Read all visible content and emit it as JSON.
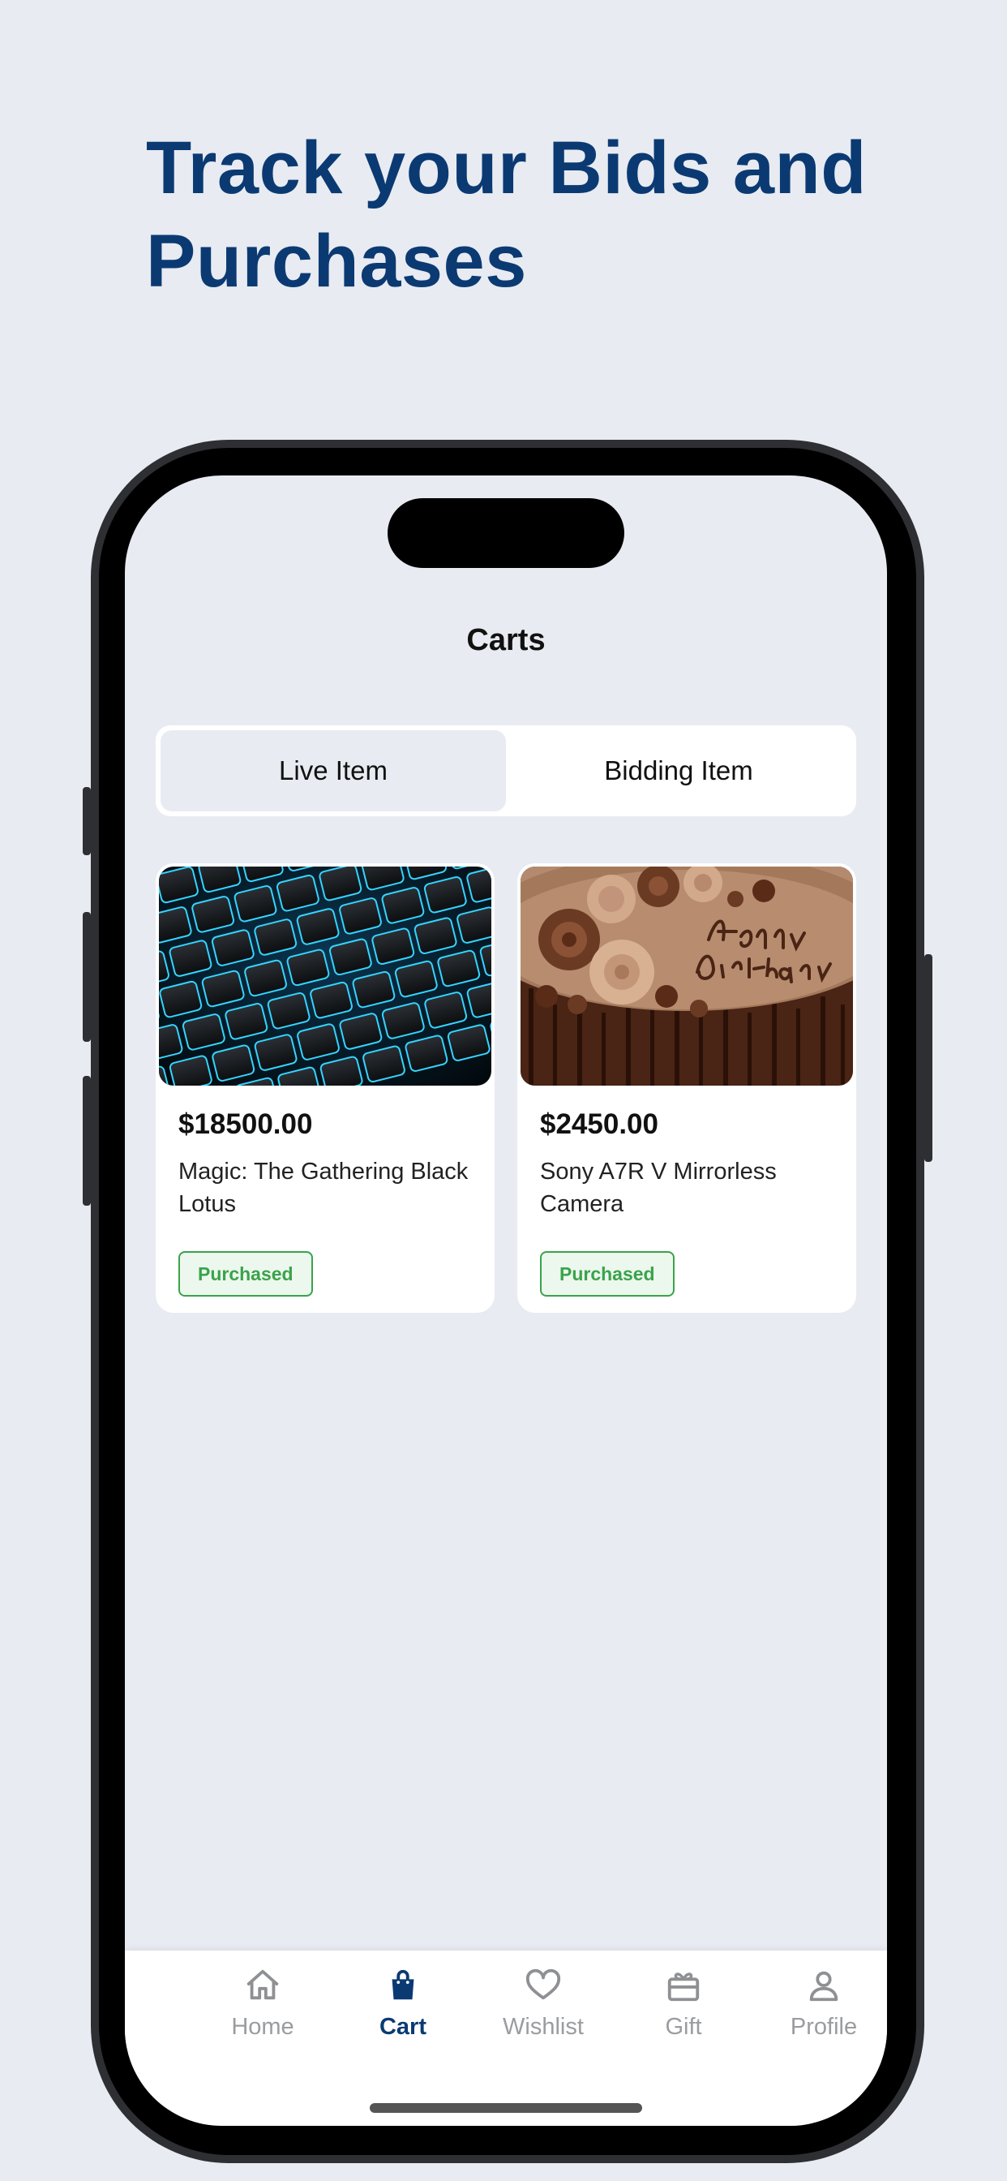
{
  "headline": "Track your Bids and Purchases",
  "screen": {
    "title": "Carts"
  },
  "segments": [
    {
      "label": "Live Item",
      "active": true
    },
    {
      "label": "Bidding Item",
      "active": false
    }
  ],
  "products": [
    {
      "price": "$18500.00",
      "name": "Magic: The Gathering Black Lotus",
      "status": "Purchased",
      "image": "keyboard-photo"
    },
    {
      "price": "$2450.00",
      "name": "Sony A7R V Mirrorless Camera",
      "status": "Purchased",
      "image": "birthday-cake-photo"
    }
  ],
  "nav": [
    {
      "label": "Home",
      "icon": "home-icon",
      "active": false
    },
    {
      "label": "Cart",
      "icon": "shopping-bag-icon",
      "active": true
    },
    {
      "label": "Wishlist",
      "icon": "heart-icon",
      "active": false
    },
    {
      "label": "Gift",
      "icon": "gift-icon",
      "active": false
    },
    {
      "label": "Profile",
      "icon": "profile-icon",
      "active": false
    }
  ],
  "colors": {
    "brand": "#0b3a73",
    "background": "#e8ebf1",
    "success": "#3aa34a",
    "inactive": "#9a9ca0"
  }
}
